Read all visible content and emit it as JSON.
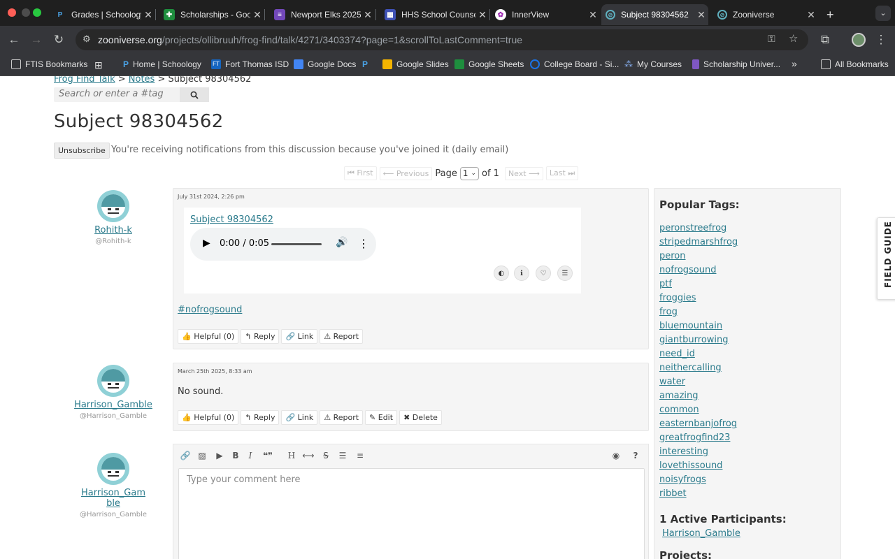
{
  "browser": {
    "tabs": [
      {
        "title": "Grades | Schoology",
        "favicon": "schoology-icon",
        "active": false
      },
      {
        "title": "Scholarships - Google Sheets",
        "favicon": "sheets-icon",
        "active": false
      },
      {
        "title": "Newport Elks 2025",
        "favicon": "forms-icon",
        "active": false
      },
      {
        "title": "HHS School Counseling",
        "favicon": "calendar-icon",
        "active": false
      },
      {
        "title": "InnerView",
        "favicon": "innerview-icon",
        "active": false
      },
      {
        "title": "Subject 98304562",
        "favicon": "zooniverse-icon",
        "active": true
      },
      {
        "title": "Zooniverse",
        "favicon": "zooniverse-icon",
        "active": false
      }
    ],
    "new_tab": "+",
    "url_host": "zooniverse.org",
    "url_path": "/projects/ollibruuh/frog-find/talk/4271/3403374?page=1&scrollToLastComment=true",
    "bookmarks": [
      {
        "label": "FTIS Bookmarks",
        "icon": "folder-icon"
      },
      {
        "label": "",
        "icon": "apps-grid-icon"
      },
      {
        "label": "",
        "icon": "schoology-icon"
      },
      {
        "label": "Home | Schoology",
        "icon": "schoology-icon"
      },
      {
        "label": "Fort Thomas ISD",
        "icon": "ft-icon"
      },
      {
        "label": "Google Docs",
        "icon": "docs-icon"
      },
      {
        "label": "",
        "icon": "schoology-icon"
      },
      {
        "label": "Google Slides",
        "icon": "slides-icon"
      },
      {
        "label": "Google Sheets",
        "icon": "sheets-icon"
      },
      {
        "label": "College Board - Si...",
        "icon": "collegeboard-icon"
      },
      {
        "label": "My Courses",
        "icon": "courses-icon"
      },
      {
        "label": "Scholarship Univer...",
        "icon": "scholarship-icon"
      }
    ],
    "more_bookmarks": "»",
    "all_bookmarks": "All Bookmarks"
  },
  "breadcrumb": {
    "talk": "Frog Find Talk",
    "sep1": " > ",
    "notes": "Notes",
    "sep2": " > ",
    "current": "Subject 98304562"
  },
  "search": {
    "placeholder": "Search or enter a #tag"
  },
  "page_title": "Subject 98304562",
  "subscription": {
    "button": "Unsubscribe",
    "notice": "You're receiving notifications from this discussion because you've joined it (daily email)"
  },
  "pagination": {
    "first": "First",
    "previous": "Previous",
    "page_label": "Page",
    "current_page": "1",
    "of_label": "of 1",
    "next": "Next",
    "last": "Last"
  },
  "comments": [
    {
      "display_name": "Rohith-k",
      "handle": "@Rohith-k",
      "date": "July 31st 2024, 2:26 pm",
      "subject_link": "Subject 98304562",
      "audio_time": "0:00 / 0:05",
      "hashtag": "#nofrogsound",
      "actions": [
        "Helpful (0)",
        "Reply",
        "Link",
        "Report"
      ]
    },
    {
      "display_name": "Harrison_Gamble",
      "handle": "@Harrison_Gamble",
      "date": "March 25th 2025, 8:33 am",
      "body": "No sound.",
      "actions": [
        "Helpful (0)",
        "Reply",
        "Link",
        "Report",
        "Edit",
        "Delete"
      ]
    }
  ],
  "composer": {
    "display_name_line1": "Harrison_Gam",
    "display_name_line2": "ble",
    "handle": "@Harrison_Gamble",
    "placeholder": "Type your comment here"
  },
  "sidebar": {
    "popular_tags_heading": "Popular Tags:",
    "tags": [
      "peronstreefrog",
      "stripedmarshfrog",
      "peron",
      "nofrogsound",
      "ptf",
      "froggies",
      "frog",
      "bluemountain",
      "giantburrowing",
      "need_id",
      "neithercalling",
      "water",
      "amazing",
      "common",
      "easternbanjofrog",
      "greatfrogfind23",
      "interesting",
      "lovethissound",
      "noisyfrogs",
      "ribbet"
    ],
    "participants_heading": "1 Active Participants:",
    "participant": "Harrison_Gamble",
    "projects_heading": "Projects:"
  },
  "field_guide": "FIELD GUIDE",
  "colors": {
    "link": "#2b7b8c",
    "avatar_ring": "#8fd0d6",
    "chrome_dark": "#1f1f1f"
  }
}
